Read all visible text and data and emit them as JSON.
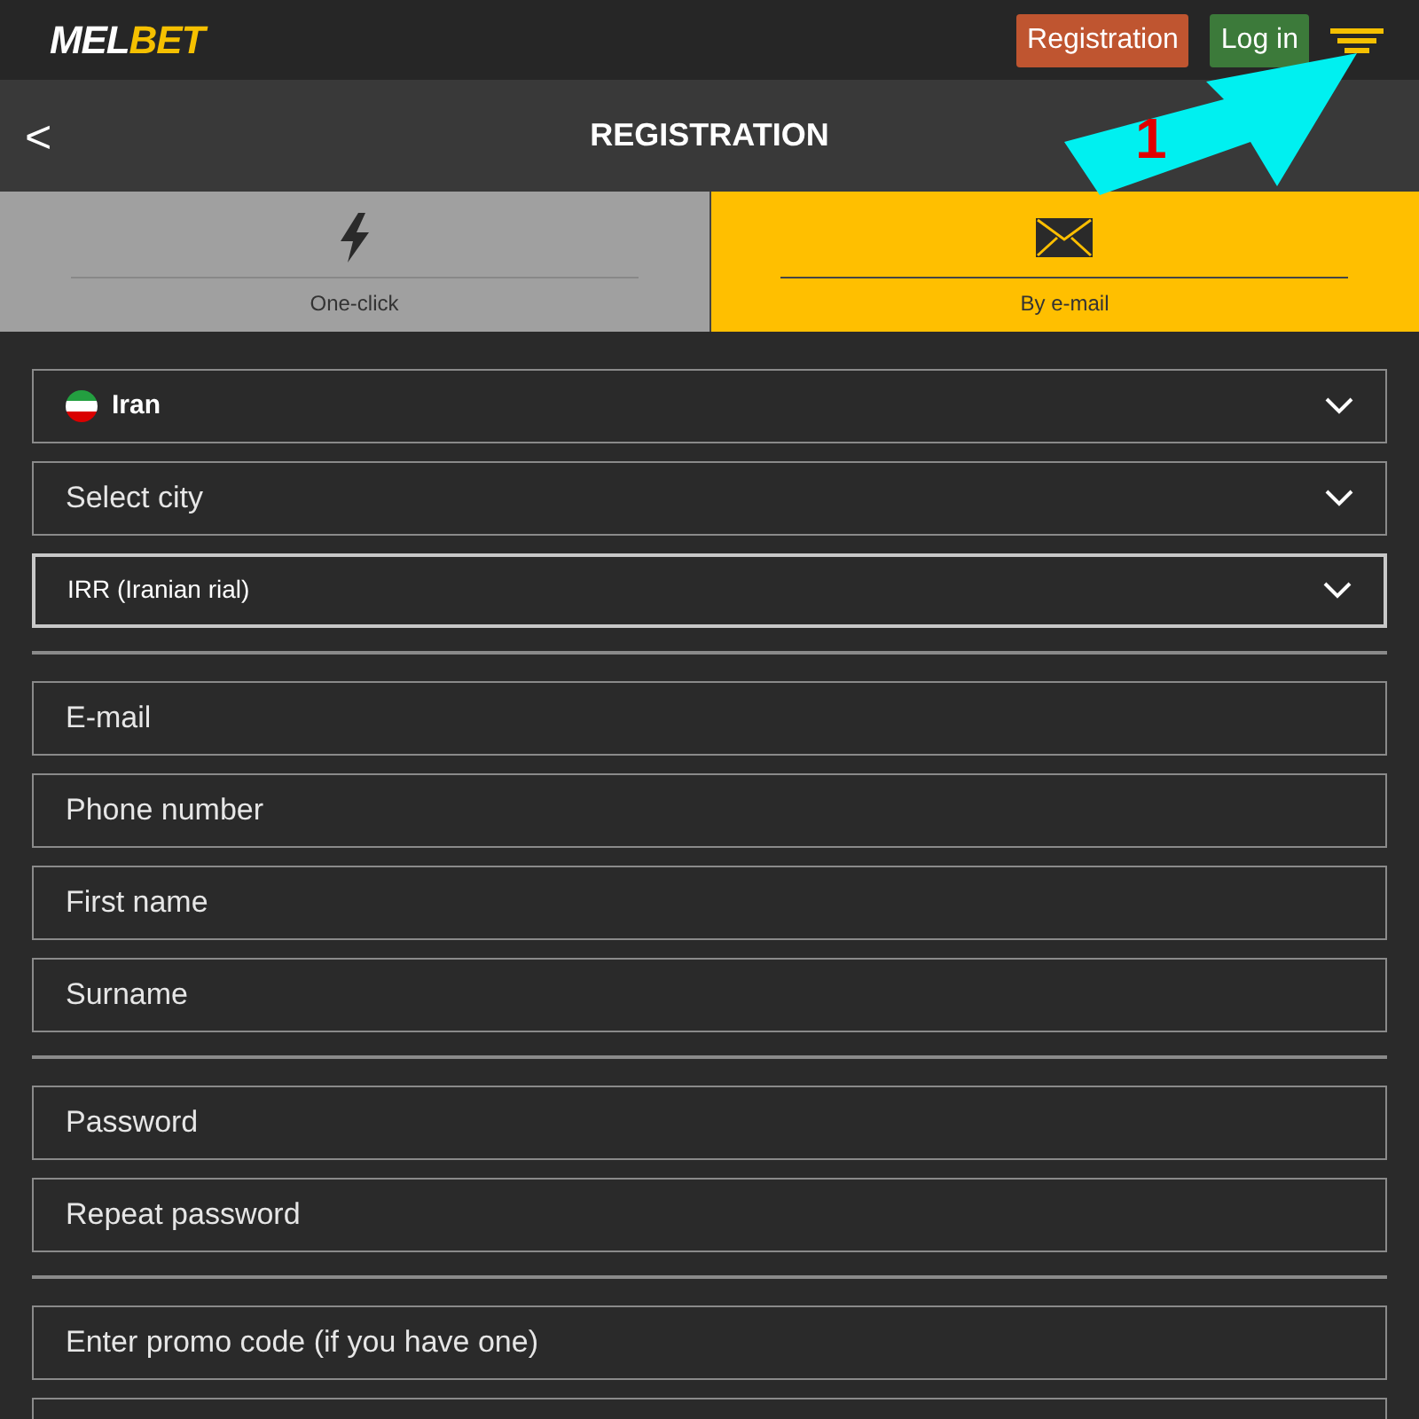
{
  "header": {
    "logo_left": "MEL",
    "logo_right": "BET",
    "buttons": [
      {
        "label": "Registration",
        "kind": "register"
      },
      {
        "label": "Log in",
        "kind": "login"
      }
    ]
  },
  "title_bar": {
    "back": "<",
    "title": "REGISTRATION"
  },
  "tabs": [
    {
      "label": "One-click",
      "selected": false
    },
    {
      "label": "By e-mail",
      "selected": true
    }
  ],
  "groups": [
    [
      {
        "kind": "select",
        "value": "Iran",
        "flag": true,
        "focused": false
      },
      {
        "kind": "select",
        "placeholder": "Select city",
        "focused": false
      },
      {
        "kind": "select",
        "value": "IRR (Iranian rial)",
        "focused": true
      }
    ],
    [
      {
        "kind": "input",
        "placeholder": "E-mail",
        "focused": false
      },
      {
        "kind": "input",
        "placeholder": "Phone number",
        "focused": false
      },
      {
        "kind": "input",
        "placeholder": "First name",
        "focused": false
      },
      {
        "kind": "input",
        "placeholder": "Surname",
        "focused": false
      }
    ],
    [
      {
        "kind": "input",
        "placeholder": "Password",
        "focused": false
      },
      {
        "kind": "input",
        "placeholder": "Repeat password",
        "focused": false
      }
    ],
    [
      {
        "kind": "input",
        "placeholder": "Enter promo code (if you have one)",
        "focused": false
      },
      {
        "kind": "input",
        "focused": false
      }
    ]
  ],
  "annotation": {
    "label": "1"
  }
}
